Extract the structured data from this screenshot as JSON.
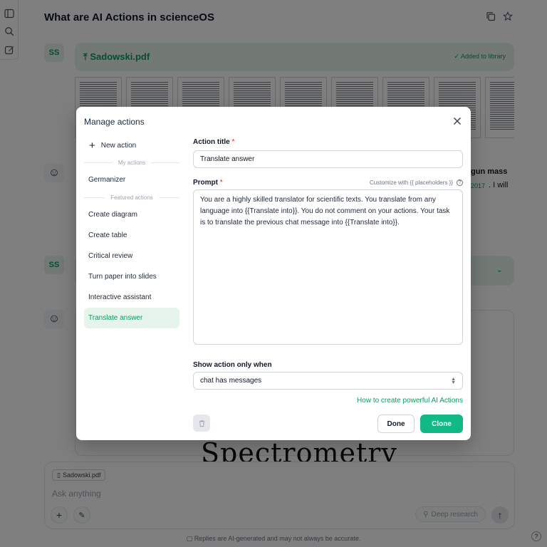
{
  "chat": {
    "title": "What are AI Actions in scienceOS",
    "user_initials": "SS",
    "file_name": "Sadowski.pdf",
    "file_status": "Added to library",
    "bg_snippet_right": "gun mass",
    "bg_snippet_year": "2017",
    "bg_snippet_tail": ". I will",
    "spectro_word": "Spectrometry"
  },
  "composer": {
    "chip_label": "Sadowski.pdf",
    "placeholder": "Ask anything",
    "deep_research": "Deep research",
    "disclaimer": "Replies are AI-generated and may not always be accurate.",
    "help": "?"
  },
  "modal": {
    "title": "Manage actions",
    "new_action": "New action",
    "my_actions_label": "My actions",
    "my_actions": [
      {
        "label": "Germanizer"
      }
    ],
    "featured_label": "Featured actions",
    "featured_actions": [
      {
        "label": "Create diagram"
      },
      {
        "label": "Create table"
      },
      {
        "label": "Critical review"
      },
      {
        "label": "Turn paper into slides"
      },
      {
        "label": "Interactive assistant"
      },
      {
        "label": "Translate answer"
      }
    ],
    "active_action": "Translate answer",
    "form": {
      "title_label": "Action title",
      "title_value": "Translate answer",
      "prompt_label": "Prompt",
      "customize_hint": "Customize with {{ placeholders }}",
      "prompt_value": "You are a highly skilled translator for scientific texts. You translate from any language into {{Translate into}}. You do not comment on your actions. Your task is to translate the previous chat message into {{Translate into}}.",
      "show_when_label": "Show action only when",
      "show_when_value": "chat has messages",
      "how_to_link": "How to create powerful AI Actions",
      "required_mark": "*"
    },
    "buttons": {
      "done": "Done",
      "clone": "Clone"
    }
  },
  "colors": {
    "accent": "#12b886",
    "accent_text": "#0f9960",
    "active_bg": "#e6f4ec",
    "required": "#dc2626"
  }
}
